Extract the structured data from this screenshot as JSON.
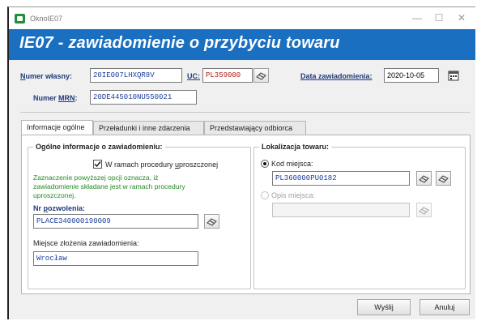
{
  "window": {
    "title": "OknoIE07",
    "minimize": "—",
    "maximize": "☐",
    "close": "✕"
  },
  "banner": {
    "title": "IE07 - zawiadomienie o przybyciu towaru"
  },
  "header": {
    "numer_wlasny_label_pre": "N",
    "numer_wlasny_label_rest": "umer własny:",
    "numer_wlasny_value": "20IE007LHXQR8V",
    "uc_label": "UC:",
    "uc_value": "PL359000",
    "data_label": "Data zawiadomienia:",
    "data_value": "2020-10-05",
    "mrn_label_pre": "Numer ",
    "mrn_label_u": "MRN",
    "mrn_label_post": ":",
    "mrn_value": "20DE445010NU550021"
  },
  "tabs": [
    "Informacje ogólne",
    "Przeładunki i inne zdarzenia",
    "Przedstawiający odbiorca"
  ],
  "general": {
    "group_title": "Ogólne informacje o zawiadomieniu:",
    "checkbox_label_pre": "W ramach procedury ",
    "checkbox_label_u": "u",
    "checkbox_label_post": "proszczonej",
    "checkbox_checked": true,
    "note_lines": [
      "Zaznaczenie powyższej opcji oznacza, iż",
      "zawiadomienie składane jest w ramach procedury",
      "uproszczonej."
    ],
    "nr_label_pre": "Nr ",
    "nr_label_u": "p",
    "nr_label_post": "ozwolenia:",
    "nr_value": "PLACE340000190009",
    "miejsce_label": "Miejsce złożenia zawiadomienia:",
    "miejsce_value": "Wrocław"
  },
  "location": {
    "group_title": "Lokalizacja towaru:",
    "kod_label": "Kod miejsca:",
    "kod_value": "PL360000PU0182",
    "opis_label": "Opis miejsca:",
    "opis_value": ""
  },
  "footer": {
    "send_label": "Wyślij",
    "cancel_label": "Anuluj"
  }
}
